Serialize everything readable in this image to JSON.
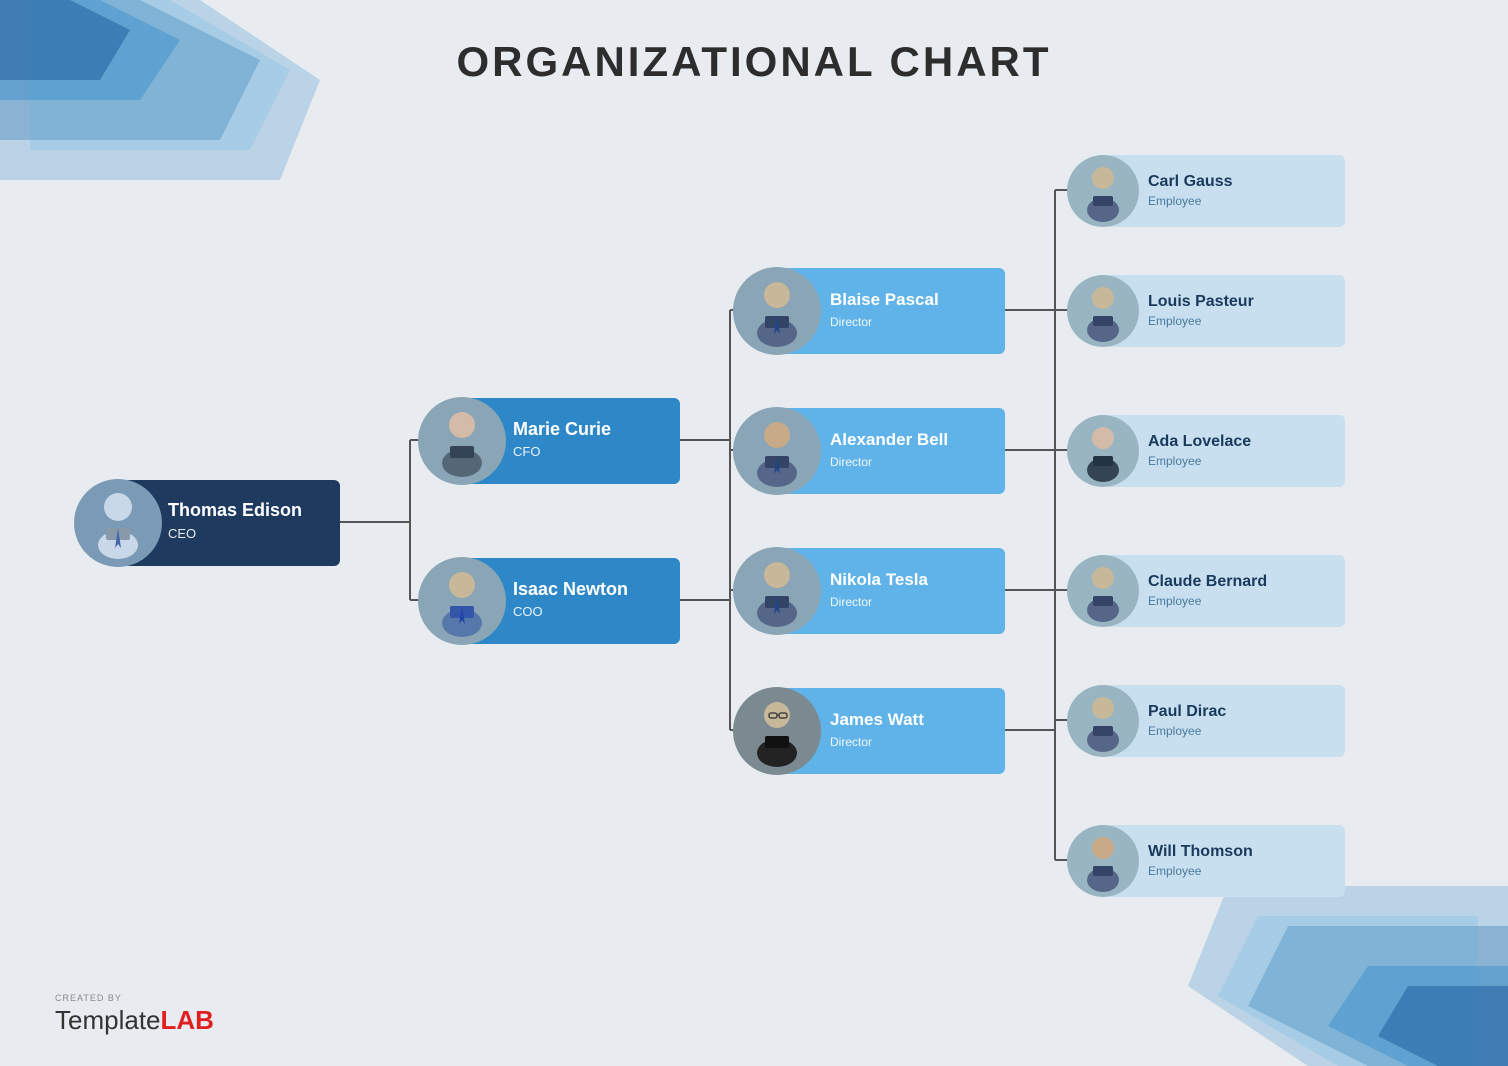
{
  "title": "ORGANIZATIONAL CHART",
  "colors": {
    "bg": "#e8ecf0",
    "dark_card": "#1e3a5f",
    "blue_card": "#2e88c8",
    "light_card": "#5fb3e8",
    "emp_card": "#c8dff0",
    "line": "#555555"
  },
  "ceo": {
    "name": "Thomas Edison",
    "role": "CEO"
  },
  "level2": [
    {
      "name": "Marie Curie",
      "role": "CFO",
      "gender": "female"
    },
    {
      "name": "Isaac Newton",
      "role": "COO",
      "gender": "male"
    }
  ],
  "directors": [
    {
      "name": "Blaise Pascal",
      "role": "Director"
    },
    {
      "name": "Alexander Bell",
      "role": "Director"
    },
    {
      "name": "Nikola Tesla",
      "role": "Director"
    },
    {
      "name": "James Watt",
      "role": "Director",
      "glasses": true
    }
  ],
  "employees": [
    {
      "name": "Carl Gauss",
      "role": "Employee"
    },
    {
      "name": "Louis Pasteur",
      "role": "Employee"
    },
    {
      "name": "Ada Lovelace",
      "role": "Employee",
      "gender": "female"
    },
    {
      "name": "Claude Bernard",
      "role": "Employee"
    },
    {
      "name": "Paul Dirac",
      "role": "Employee"
    },
    {
      "name": "Will Thomson",
      "role": "Employee"
    }
  ],
  "logo": {
    "created_by": "CREATED BY",
    "brand_template": "Template",
    "brand_lab": "LAB"
  }
}
